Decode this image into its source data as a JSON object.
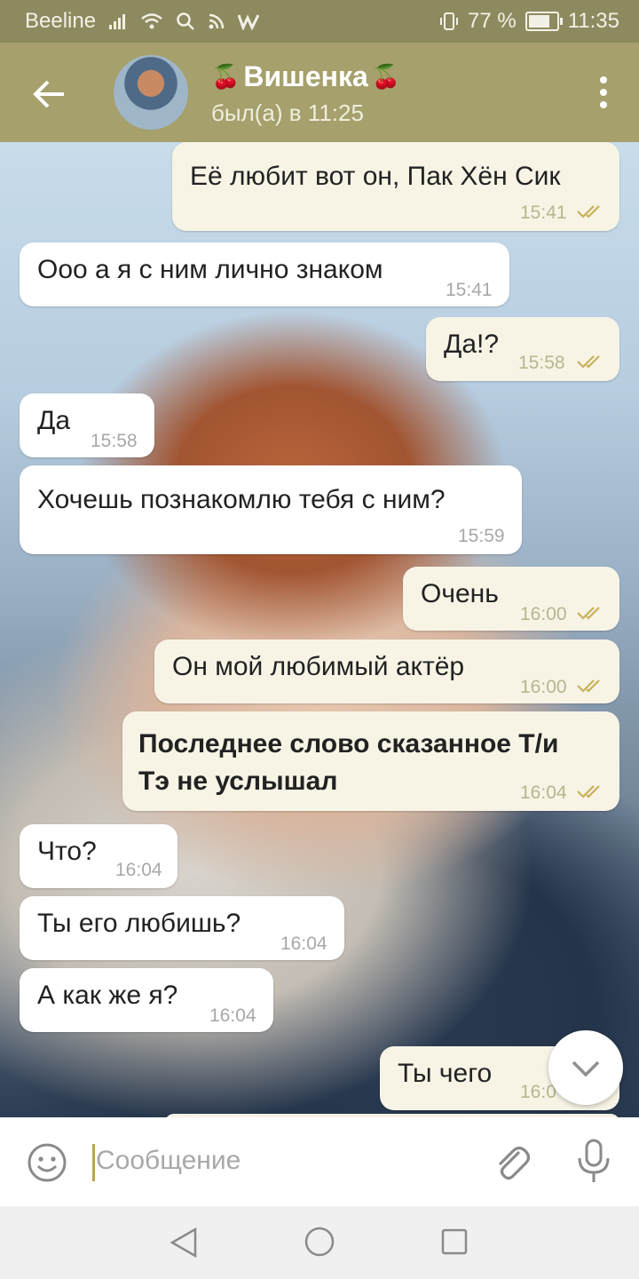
{
  "status_bar": {
    "carrier": "Beeline",
    "battery_percent": "77 %",
    "battery_level": 0.77,
    "time": "11:35"
  },
  "header": {
    "contact_name": "Вишенка",
    "name_emoji": "🍒",
    "last_seen": "был(а) в 11:25"
  },
  "messages": [
    {
      "direction": "out",
      "text": "Её любит вот он, Пак Хён Сик",
      "time": "15:41",
      "read": true
    },
    {
      "direction": "in",
      "text": "Ооо а я с ним лично знаком",
      "time": "15:41"
    },
    {
      "direction": "out",
      "text": "Да!?",
      "time": "15:58",
      "read": true
    },
    {
      "direction": "in",
      "text": "Да",
      "time": "15:58"
    },
    {
      "direction": "in",
      "text": "Хочешь познакомлю тебя с ним?",
      "time": "15:59"
    },
    {
      "direction": "out",
      "text": "Очень",
      "time": "16:00",
      "read": true
    },
    {
      "direction": "out",
      "text": "Он мой любимый актёр",
      "time": "16:00",
      "read": true
    },
    {
      "direction": "out",
      "text_line1": "Последнее слово сказанное Т/и",
      "text_line2": "Тэ не услышал",
      "time": "16:04",
      "read": true,
      "bold": true
    },
    {
      "direction": "in",
      "text": "Что?",
      "time": "16:04"
    },
    {
      "direction": "in",
      "text": "Ты его любишь?",
      "time": "16:04"
    },
    {
      "direction": "in",
      "text": "А как же я?",
      "time": "16:04"
    },
    {
      "direction": "out",
      "text": "Ты чего",
      "time": "16:0",
      "read": true
    }
  ],
  "composer": {
    "placeholder": "Сообщение"
  },
  "colors": {
    "header": "#a5a06c",
    "status_bar": "#8d8a5f",
    "outgoing_bubble": "#f7f4e6",
    "incoming_bubble": "#ffffff",
    "check_marks": "#c9b15a",
    "caret": "#b9a64a"
  },
  "icons": {
    "back": "arrow-left-icon",
    "menu": "more-vertical-icon",
    "emoji": "smiley-icon",
    "attach": "paperclip-icon",
    "mic": "microphone-icon",
    "scroll_down": "chevron-down-icon",
    "nav_back": "triangle-back-icon",
    "nav_home": "circle-home-icon",
    "nav_recent": "square-recent-icon"
  }
}
